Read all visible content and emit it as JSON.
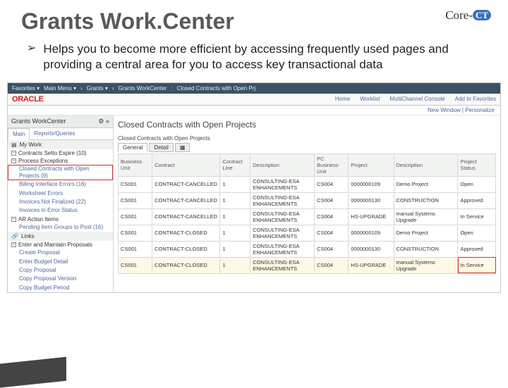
{
  "slide": {
    "title": "Grants Work.Center",
    "bullet": "Helps you to become more efficient by accessing frequently used pages and providing a central area for you to access key transactional data",
    "logo_core": "Core-",
    "logo_ct": "CT"
  },
  "breadcrumb": {
    "favorites": "Favorites ▾",
    "mainmenu": "Main Menu ▾",
    "sep1": "›",
    "grants": "Grants ▾",
    "sep2": "›",
    "wc": "Grants WorkCenter",
    "sep3": ":",
    "page": "Closed Contracts with Open Prj"
  },
  "topbar": {
    "brand": "ORACLE",
    "links": [
      "Home",
      "Worklist",
      "MultiChannel Console",
      "Add to Favorites"
    ]
  },
  "sublinks": "New Window | Personalize",
  "sidebar": {
    "title": "Grants WorkCenter",
    "tabs": {
      "main": "Main",
      "reports": "Reports/Queries"
    },
    "mywork": "My Work",
    "sec1": "Contracts Setto Expire (10)",
    "sec2": "Process Exceptions",
    "items2": [
      "Closed Contracts with Open Projects (9)",
      "Billing Interface Errors (16)",
      "Worksheet Errors",
      "Invoices Not Finalized (22)",
      "Invoices in Error Status"
    ],
    "sec3": "AR Action Items",
    "items3": [
      "Pending Item Groups to Post (16)"
    ],
    "links_hdr": "Links",
    "sec4": "Enter and Maintain Proposals",
    "items4": [
      "Create Proposal",
      "Enter Budget Detail",
      "Copy Proposal",
      "Copy Proposal Version",
      "Copy Budget Period"
    ]
  },
  "main": {
    "page_title": "Closed Contracts with Open Projects",
    "panel_title": "Closed Contracts with Open Projects",
    "tabs": [
      "General",
      "Detail",
      "▦"
    ],
    "headers": [
      "Business Unit",
      "Contract",
      "Contract Line",
      "Description",
      "PC Business Unit",
      "Project",
      "Description",
      "Project Status"
    ],
    "rows": [
      [
        "CS001",
        "CONTRACT-CANCELLED",
        "1",
        "CONSULTING-ESA ENHANCEMENTS",
        "CS004",
        "0000000109",
        "Demo Project",
        "Open"
      ],
      [
        "CS001",
        "CONTRACT-CANCELLED",
        "1",
        "CONSULTING-ESA ENHANCEMENTS",
        "CS004",
        "0000000130",
        "CONSTRUCTION",
        "Approved"
      ],
      [
        "CS001",
        "CONTRACT-CANCELLED",
        "1",
        "CONSULTING-ESA ENHANCEMENTS",
        "CS004",
        "HS-UPGRADE",
        "manual Systems Upgrade",
        "In Service"
      ],
      [
        "CS001",
        "CONTRACT-CLOSED",
        "1",
        "CONSULTING-ESA ENHANCEMENTS",
        "CS004",
        "0000000109",
        "Demo Project",
        "Open"
      ],
      [
        "CS001",
        "CONTRACT-CLOSED",
        "1",
        "CONSULTING-ESA ENHANCEMENTS",
        "CS004",
        "0000000130",
        "CONSTRUCTION",
        "Approved"
      ],
      [
        "CS001",
        "CONTRACT-CLOSED",
        "1",
        "CONSULTING-ESA ENHANCEMENTS",
        "CS004",
        "HS-UPGRADE",
        "manual Systems Upgrade",
        "In Service"
      ]
    ],
    "highlight_row": 5
  }
}
